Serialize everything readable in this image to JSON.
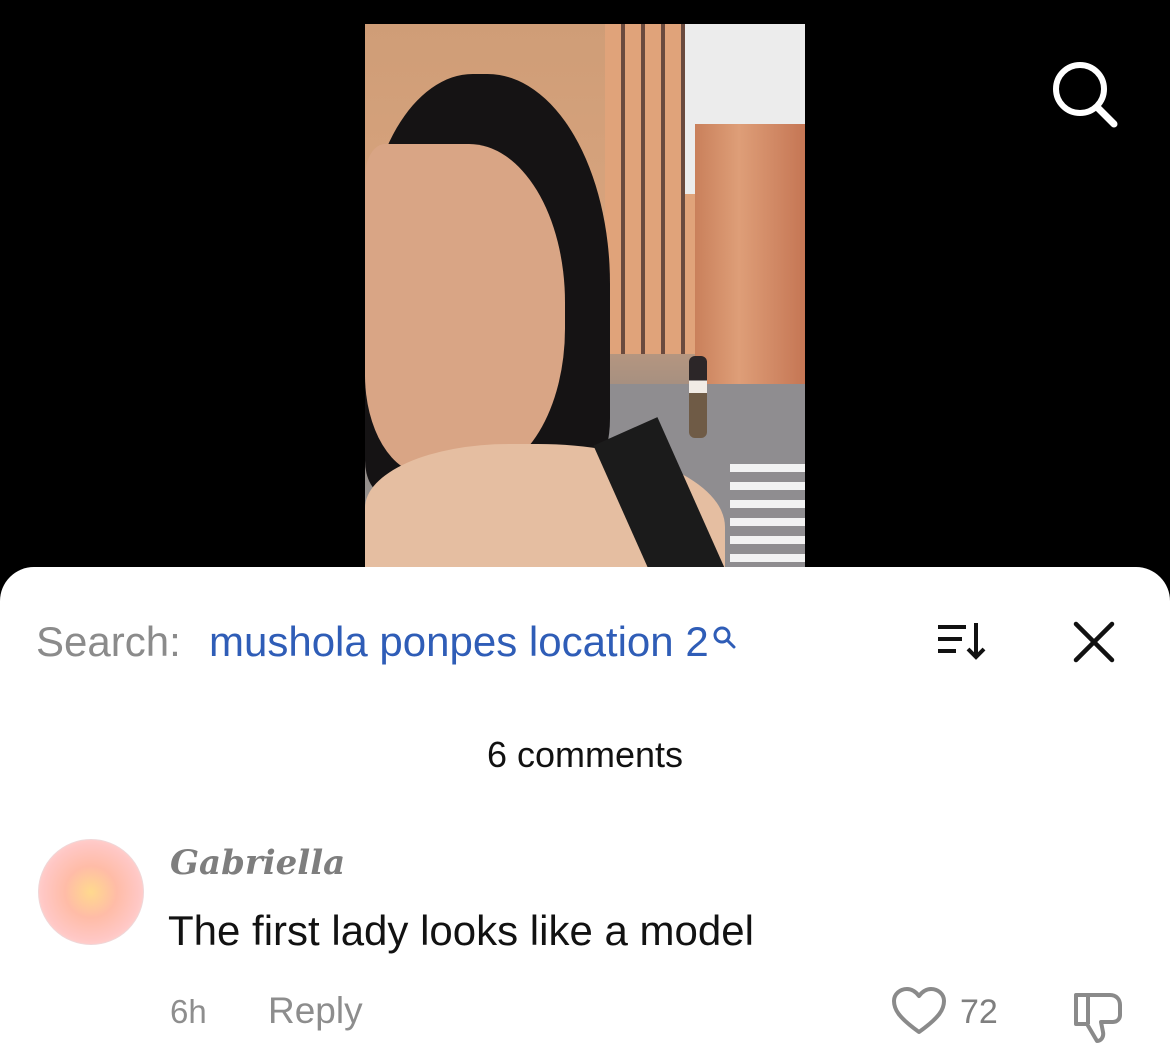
{
  "colors": {
    "background": "#000000",
    "sheet": "#ffffff",
    "search_label": "#8b8b8b",
    "search_query": "#2f5db7",
    "meta_text": "#8e8e8e"
  },
  "icons": {
    "top_search": "search-icon",
    "sort": "sort-icon",
    "close": "close-icon",
    "like": "heart-icon",
    "dislike": "thumbs-down-icon"
  },
  "search": {
    "label": "Search:",
    "query": "mushola ponpes location 2"
  },
  "comments": {
    "count_label": "6 comments",
    "items": [
      {
        "author": "Gabriella",
        "text": "The first lady looks like a model",
        "time": "6h",
        "reply_label": "Reply",
        "likes": "72"
      }
    ]
  }
}
